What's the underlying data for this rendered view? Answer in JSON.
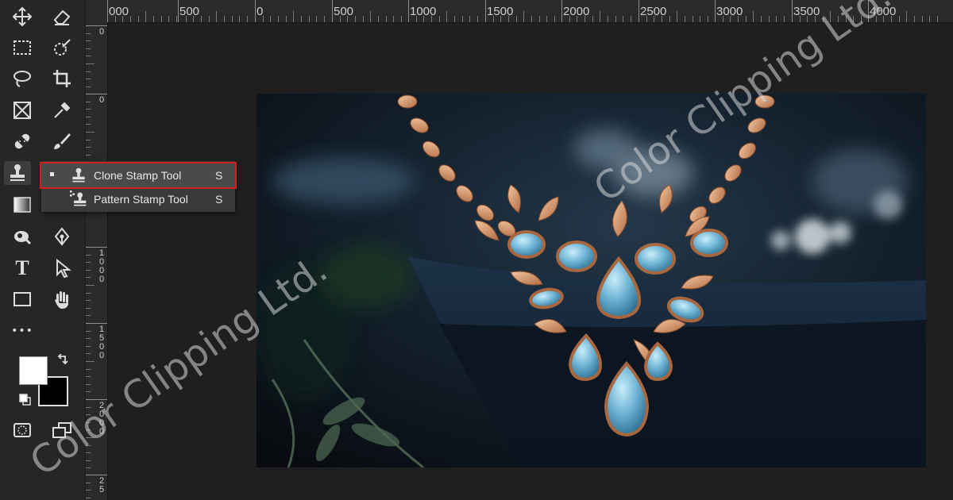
{
  "ruler": {
    "top_labels": [
      "000",
      "500",
      "0",
      "500",
      "1000",
      "1500",
      "2000",
      "2500",
      "3000",
      "3500",
      "4000"
    ],
    "left_labels": [
      "0",
      "0",
      "1000",
      "1500",
      "2000",
      "25"
    ]
  },
  "toolbar": {
    "tools": [
      {
        "name": "move-tool",
        "icon": "move-icon"
      },
      {
        "name": "eraser-tool",
        "icon": "eraser-icon"
      },
      {
        "name": "marquee-tool",
        "icon": "rect-marquee-icon"
      },
      {
        "name": "quick-selection-tool",
        "icon": "quick-selection-icon"
      },
      {
        "name": "lasso-tool",
        "icon": "lasso-icon"
      },
      {
        "name": "crop-tool",
        "icon": "crop-icon"
      },
      {
        "name": "frame-tool",
        "icon": "frame-icon"
      },
      {
        "name": "eyedropper-tool",
        "icon": "eyedropper-icon"
      },
      {
        "name": "healing-brush-tool",
        "icon": "bandage-icon"
      },
      {
        "name": "brush-tool",
        "icon": "brush-icon"
      },
      {
        "name": "clone-stamp-tool",
        "icon": "stamp-icon"
      },
      {
        "name": "gradient-tool",
        "icon": "gradient-icon"
      },
      {
        "name": "dodge-tool",
        "icon": "dodge-icon"
      },
      {
        "name": "pen-tool",
        "icon": "pen-icon"
      },
      {
        "name": "type-tool",
        "icon": "type-icon"
      },
      {
        "name": "path-selection-tool",
        "icon": "arrow-icon"
      },
      {
        "name": "rectangle-tool",
        "icon": "rectangle-icon"
      },
      {
        "name": "hand-tool",
        "icon": "hand-icon"
      },
      {
        "name": "more-tools",
        "icon": "ellipsis-icon"
      }
    ],
    "type_glyph": "T",
    "more_glyph": "•••",
    "foreground_color": "#ffffff",
    "background_color": "#000000"
  },
  "flyout": {
    "items": [
      {
        "label": "Clone Stamp Tool",
        "shortcut": "S",
        "selected": true
      },
      {
        "label": "Pattern Stamp Tool",
        "shortcut": "S",
        "selected": false
      }
    ]
  },
  "watermark": {
    "text": "Color Clipping Ltd."
  },
  "colors": {
    "highlight": "#d11f1f",
    "panel": "#262626",
    "canvas": "#1f1f1f"
  }
}
